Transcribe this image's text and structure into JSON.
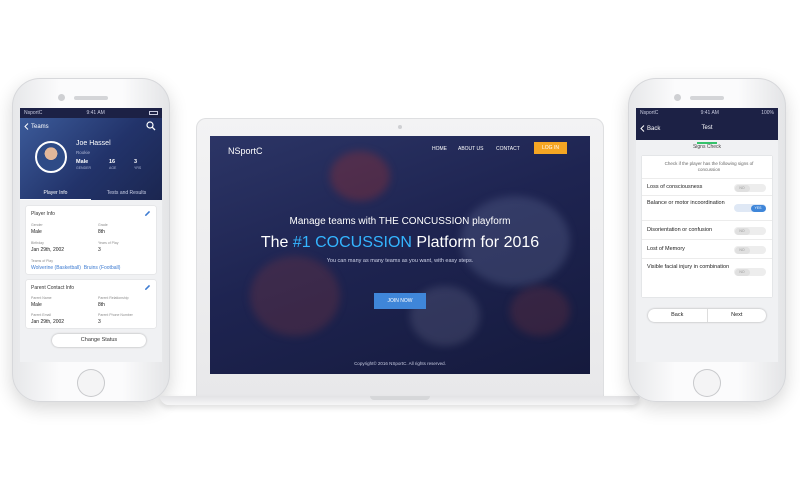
{
  "left_phone": {
    "status": {
      "carrier": "NsportC",
      "time": "9:41 AM"
    },
    "nav": {
      "back_label": "Teams"
    },
    "player": {
      "name": "Joe Hassel",
      "position": "Rookie"
    },
    "stats": [
      {
        "value": "Male",
        "key": ""
      },
      {
        "value": "16",
        "key": "AGE"
      },
      {
        "value": "3",
        "key": "YRS"
      }
    ],
    "stat_gender_key": "GENDER",
    "tabs": [
      "Player Info",
      "Tests and Results"
    ],
    "player_info": {
      "title": "Player Info",
      "gender_label": "Gender",
      "gender": "Male",
      "grade_label": "Grade",
      "grade": "8th",
      "birthday_label": "Birthday",
      "birthday": "Jan 29th, 2002",
      "years_label": "Years of Play",
      "years": "3",
      "teams_label": "Teams of Play",
      "team_1": "Wolverine (Basketball)",
      "team_2": "Bruins (Football)"
    },
    "parent_info": {
      "title": "Parent Contact Info",
      "name_label": "Parent Name",
      "name": "Male",
      "relationship_label": "Parent Relationship",
      "relationship": "8th",
      "email_label": "Parent Email",
      "email": "Jan 29th, 2002",
      "phone_label": "Parent Phone Number",
      "phone": "3"
    },
    "change_status_label": "Change Status"
  },
  "laptop": {
    "brand": "NSportC",
    "nav": [
      "HOME",
      "ABOUT US",
      "CONTACT"
    ],
    "login_label": "LOG IN",
    "subtitle": "Manage teams with THE CONCUSSION playform",
    "title_pre": "The ",
    "title_highlight": "#1 COCUSSION",
    "title_post": " Platform for 2016",
    "description": "You can many as many teams as you want, with easy steps.",
    "join_label": "JOIN NOW",
    "copyright": "Copyright© 2016 NSportC. All rights reserved."
  },
  "right_phone": {
    "status": {
      "carrier": "NsportC",
      "time": "9:41 AM",
      "battery": "100%"
    },
    "nav": {
      "back_label": "Back",
      "title": "Test"
    },
    "section_title": "Signs Check",
    "instruction": "Check if the player has the following signs of concussion",
    "signs": [
      {
        "label": "Loss of consciousness",
        "state": "NO"
      },
      {
        "label": "Balance or motor incoordination",
        "state": "YES"
      },
      {
        "label": "Disorientation or confusion",
        "state": "NO"
      },
      {
        "label": "Lost of Memory",
        "state": "NO"
      },
      {
        "label": "Visible facial injury in combination",
        "state": "NO"
      }
    ],
    "back_button": "Back",
    "next_button": "Next"
  },
  "colors": {
    "navy": "#1c2145",
    "accent_blue": "#3f86d9",
    "highlight": "#34b5ff",
    "login_orange": "#f5a623",
    "active_green": "#34c26a"
  }
}
